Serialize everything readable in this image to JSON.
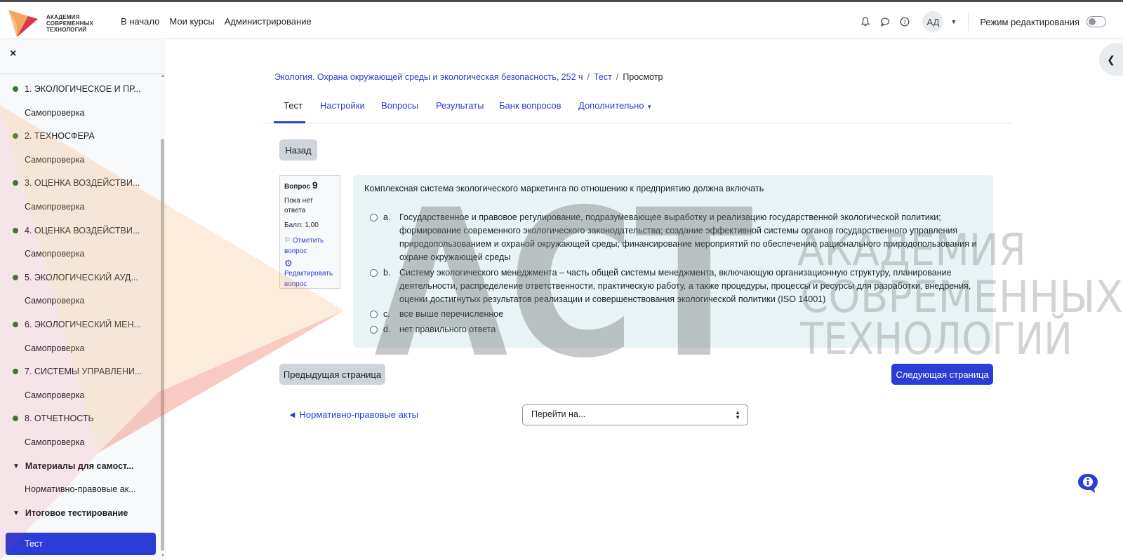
{
  "brand": {
    "logo_lines": [
      "АКАДЕМИЯ",
      "СОВРЕМЕННЫХ",
      "ТЕХНОЛОГИЙ"
    ],
    "accent": "#2c3cd6"
  },
  "nav": {
    "links": [
      "В начало",
      "Мои курсы",
      "Администрирование"
    ],
    "avatar_initials": "АД",
    "edit_mode_label": "Режим редактирования",
    "icons": [
      "bell-icon",
      "chat-icon",
      "help-icon"
    ]
  },
  "sidebar": {
    "close_label": "×",
    "items": [
      {
        "type": "section",
        "label": "1. ЭКОЛОГИЧЕСКОЕ И ПР..."
      },
      {
        "type": "sub",
        "label": "Самопроверка"
      },
      {
        "type": "section",
        "label": "2. ТЕХНОСФЕРА"
      },
      {
        "type": "sub",
        "label": "Самопроверка"
      },
      {
        "type": "section",
        "label": "3. ОЦЕНКА ВОЗДЕЙСТВИ..."
      },
      {
        "type": "sub",
        "label": "Самопроверка"
      },
      {
        "type": "section",
        "label": "4. ОЦЕНКА ВОЗДЕЙСТВИ..."
      },
      {
        "type": "sub",
        "label": "Самопроверка"
      },
      {
        "type": "section",
        "label": "5. ЭКОЛОГИЧЕСКИЙ АУД..."
      },
      {
        "type": "sub",
        "label": "Самопроверка"
      },
      {
        "type": "section",
        "label": "6. ЭКОЛОГИЧЕСКИЙ МЕН..."
      },
      {
        "type": "sub",
        "label": "Самопроверка"
      },
      {
        "type": "section",
        "label": "7. СИСТЕМЫ УПРАВЛЕНИ..."
      },
      {
        "type": "sub",
        "label": "Самопроверка"
      },
      {
        "type": "section",
        "label": "8. ОТЧЕТНОСТЬ"
      },
      {
        "type": "sub",
        "label": "Самопроверка"
      }
    ],
    "group_materials": "Материалы для самост...",
    "materials_item": "Нормативно-правовые ак...",
    "group_final": "Итоговое тестирование",
    "final_item": "Тест"
  },
  "breadcrumb": {
    "course": "Экология. Охрана окружающей среды и экологическая безопасность, 252 ч",
    "test": "Тест",
    "current": "Просмотр"
  },
  "tabs": [
    "Тест",
    "Настройки",
    "Вопросы",
    "Результаты",
    "Банк вопросов",
    "Дополнительно"
  ],
  "buttons": {
    "back": "Назад",
    "prev_page": "Предыдущая страница",
    "next_page": "Следующая страница"
  },
  "question": {
    "label": "Вопрос",
    "number": "9",
    "status": "Пока нет ответа",
    "score": "Балл: 1,00",
    "flag_link": "Отметить вопрос",
    "edit_link": "Редактировать вопрос",
    "text": "Комплексная система экологического маркетинга по отношению к предприятию должна включать",
    "answers": [
      {
        "letter": "a.",
        "text": "Государственное и правовое регулирование, подразумевающее выработку и реализацию государственной экологической политики; формирование современного экологического законодательства; создание эффективной системы органов государственного управления природопользованием и охраной окружающей среды; финансирование мероприятий по обеспечению рационального природопользования и охране окружающей среды"
      },
      {
        "letter": "b.",
        "text": "Систему экологического менеджмента – часть общей системы менеджмента, включающую организационную структуру, планирование деятельности, распределение ответственности, практическую работу, а также процедуры, процессы и ресурсы для разработки, внедрения, оценки достигнутых результатов реализации и совершенствования экологической политики (ISO 14001)"
      },
      {
        "letter": "c.",
        "text": "все выше перечисленное"
      },
      {
        "letter": "d.",
        "text": "нет правильного ответа"
      }
    ]
  },
  "quicknav": {
    "prev_link": "◄ Нормативно-правовые акты",
    "jump_placeholder": "Перейти на..."
  },
  "watermark": {
    "letters": "АСТ",
    "lines": [
      "АКАДЕМИЯ",
      "СОВРЕМЕННЫХ",
      "ТЕХНОЛОГИЙ"
    ]
  }
}
